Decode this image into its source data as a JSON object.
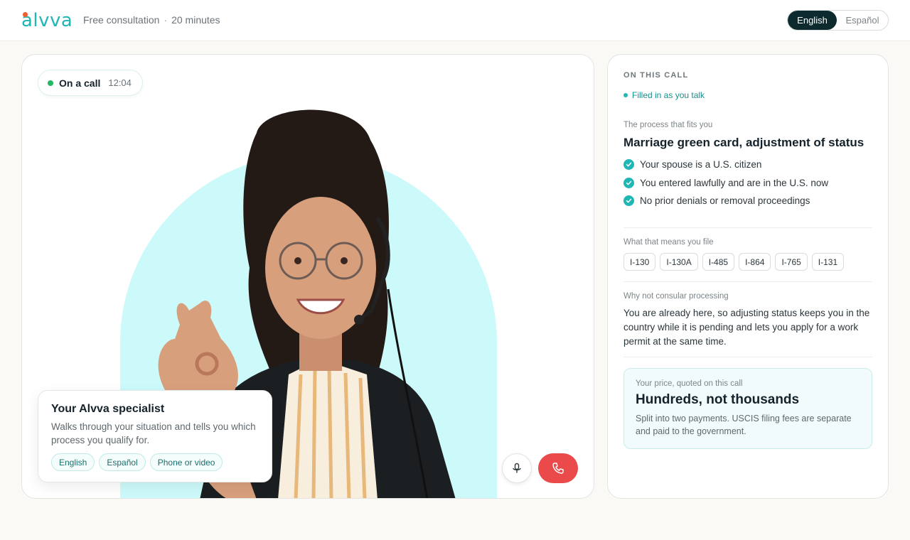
{
  "header": {
    "logo_text": "alvva",
    "subtitle_a": "Free consultation",
    "subtitle_sep": "·",
    "subtitle_b": "20 minutes",
    "lang_active": "English",
    "lang_inactive": "Español"
  },
  "call": {
    "status_label": "On a call",
    "status_time": "12:04",
    "specialist": {
      "title": "Your Alvva specialist",
      "description": "Walks through your situation and tells you which process you qualify for.",
      "tags": [
        "English",
        "Español",
        "Phone or video"
      ]
    },
    "controls": {
      "mic_icon": "mic-icon",
      "end_icon": "phone-end-icon"
    }
  },
  "panel": {
    "eyebrow": "ON THIS CALL",
    "live_label": "Filled in as you talk",
    "process_label": "The process that fits you",
    "process_title": "Marriage green card, adjustment of status",
    "checks": [
      "Your spouse is a U.S. citizen",
      "You entered lawfully and are in the U.S. now",
      "No prior denials or removal proceedings"
    ],
    "forms_label": "What that means you file",
    "forms": [
      "I-130",
      "I-130A",
      "I-485",
      "I-864",
      "I-765",
      "I-131"
    ],
    "why_label": "Why not consular processing",
    "why_text": "You are already here, so adjusting status keeps you in the country while it is pending and lets you apply for a work permit at the same time.",
    "price_label": "Your price, quoted on this call",
    "price_title": "Hundreds, not thousands",
    "price_note": "Split into two payments. USCIS filing fees are separate and paid to the government."
  },
  "colors": {
    "brand_teal": "#1fb6b3",
    "brand_orange": "#f25c2e",
    "dark": "#0d2a2e",
    "end_call_red": "#ea4a4a",
    "live_green": "#22b861"
  }
}
